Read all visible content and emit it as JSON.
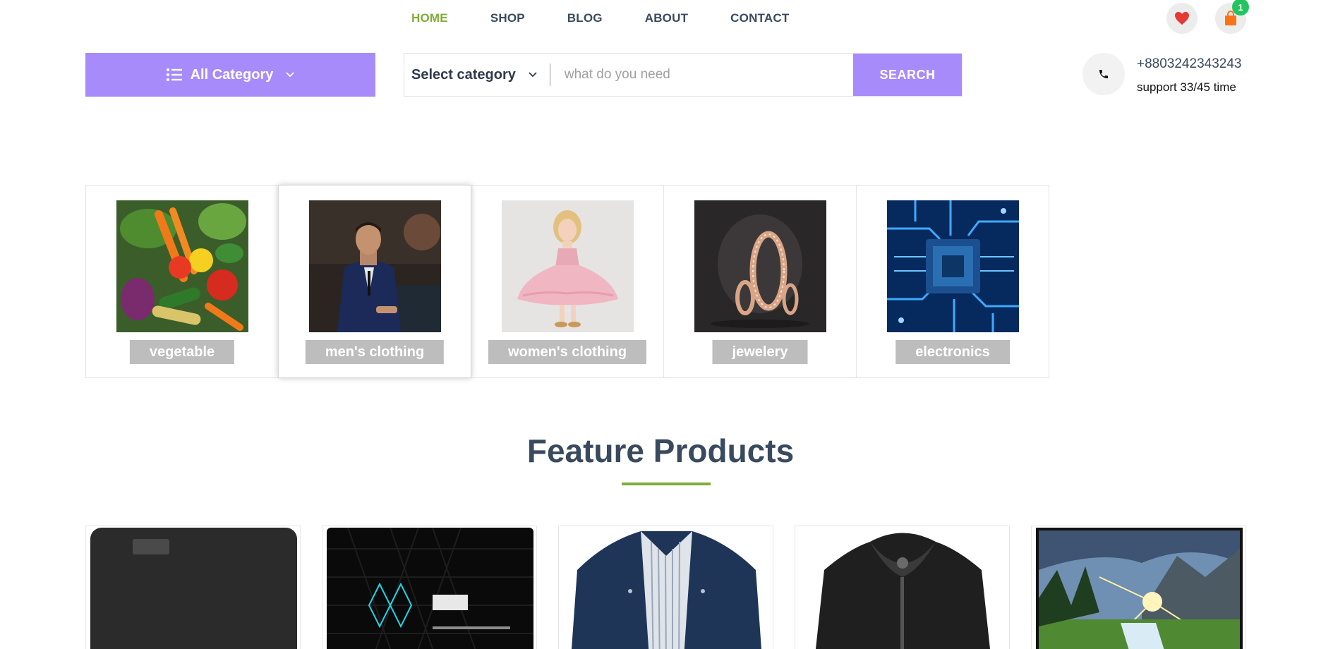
{
  "nav": {
    "links": [
      {
        "label": "HOME",
        "active": true
      },
      {
        "label": "SHOP",
        "active": false
      },
      {
        "label": "BLOG",
        "active": false
      },
      {
        "label": "ABOUT",
        "active": false
      },
      {
        "label": "CONTACT",
        "active": false
      }
    ],
    "wishlist_icon": "heart-icon",
    "cart_icon": "shopping-bag-icon",
    "cart_count": "1"
  },
  "search": {
    "all_category_label": "All Category",
    "select_category_label": "Select category",
    "placeholder": "what do you need",
    "button_label": "SEARCH"
  },
  "contact": {
    "phone": "+8803242343243",
    "support": "support 33/45 time"
  },
  "categories": [
    {
      "label": "vegetable"
    },
    {
      "label": "men's clothing"
    },
    {
      "label": "women's clothing"
    },
    {
      "label": "jewelery"
    },
    {
      "label": "electronics"
    }
  ],
  "features": {
    "title": "Feature Products"
  },
  "products": [
    {
      "image": "external-hard-drive"
    },
    {
      "image": "solid-state-drive"
    },
    {
      "image": "navy-jacket"
    },
    {
      "image": "black-leather-jacket"
    },
    {
      "image": "landscape-monitor"
    }
  ],
  "colors": {
    "accent_green": "#7fad39",
    "purple": "#a78bfa",
    "heading": "#3a4a5e",
    "badge_green": "#22c55e",
    "heart_red": "#e53935",
    "bag_orange": "#f97316"
  }
}
